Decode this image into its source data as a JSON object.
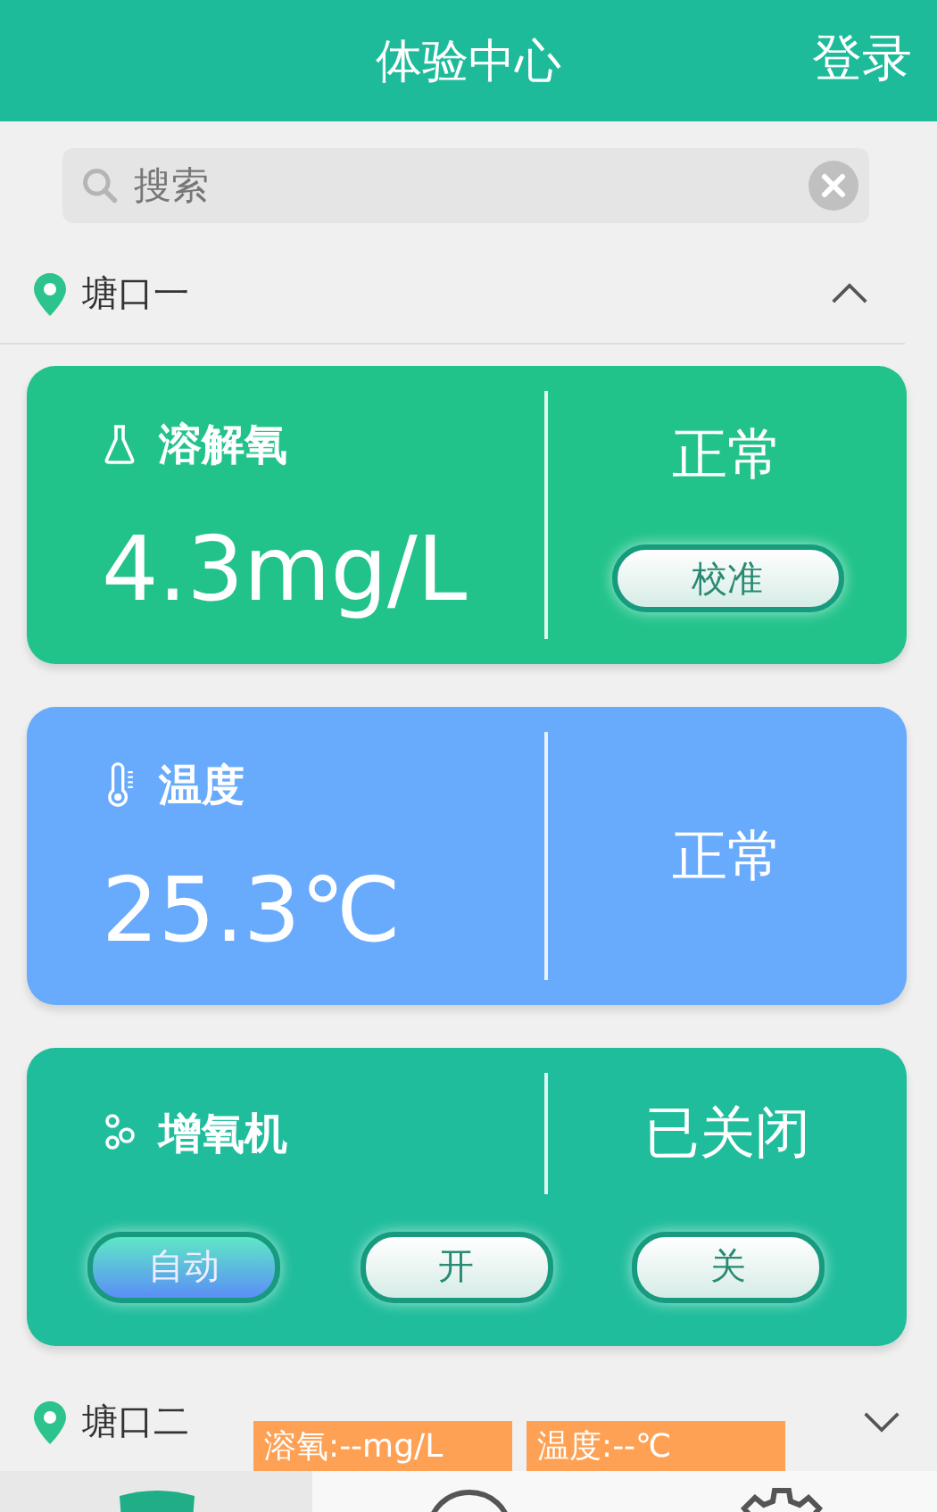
{
  "header": {
    "title": "体验中心",
    "login": "登录"
  },
  "search": {
    "placeholder": "搜索"
  },
  "ponds": [
    {
      "name": "塘口一",
      "expanded": true,
      "cards": [
        {
          "kind": "sensor",
          "title": "溶解氧",
          "value": "4.3mg/L",
          "status": "正常",
          "button": "校准",
          "color": "#22c38b"
        },
        {
          "kind": "sensor",
          "title": "温度",
          "value": "25.3℃",
          "status": "正常",
          "color": "#68aafc"
        },
        {
          "kind": "device",
          "title": "增氧机",
          "status": "已关闭",
          "color": "#1fbd9c",
          "modes": [
            {
              "label": "自动",
              "selected": true
            },
            {
              "label": "开",
              "selected": false
            },
            {
              "label": "关",
              "selected": false
            }
          ]
        }
      ]
    },
    {
      "name": "塘口二",
      "expanded": false,
      "tags": [
        "溶氧:--mg/L",
        "温度:--℃"
      ]
    }
  ],
  "tabs": [
    {
      "selected": true
    },
    {
      "selected": false
    },
    {
      "selected": false
    }
  ]
}
